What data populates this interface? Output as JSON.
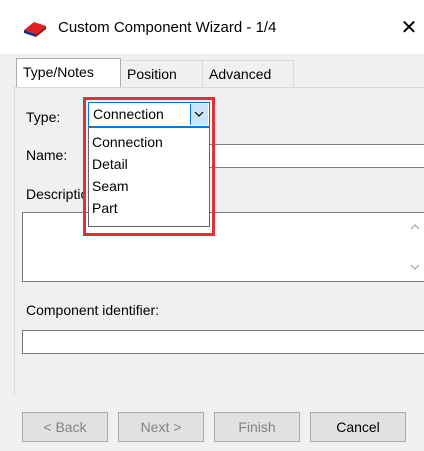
{
  "window": {
    "title": "Custom Component Wizard - 1/4",
    "close_glyph": "✕",
    "icon": "tekla-app-icon"
  },
  "tabs": [
    {
      "label": "Type/Notes",
      "active": true
    },
    {
      "label": "Position",
      "active": false
    },
    {
      "label": "Advanced",
      "active": false
    }
  ],
  "form": {
    "type_label": "Type:",
    "name_label": "Name:",
    "description_label": "Description:",
    "component_identifier_label": "Component identifier:",
    "name_value": "",
    "description_value": "",
    "component_identifier_value": ""
  },
  "type_select": {
    "selected": "Connection",
    "options": [
      "Connection",
      "Detail",
      "Seam",
      "Part"
    ],
    "expanded": true
  },
  "buttons": {
    "back": "< Back",
    "next": "Next >",
    "finish": "Finish",
    "cancel": "Cancel"
  },
  "colors": {
    "highlight": "#e0303a",
    "focus": "#0078d7",
    "dialog_bg": "#f0f0f0"
  }
}
